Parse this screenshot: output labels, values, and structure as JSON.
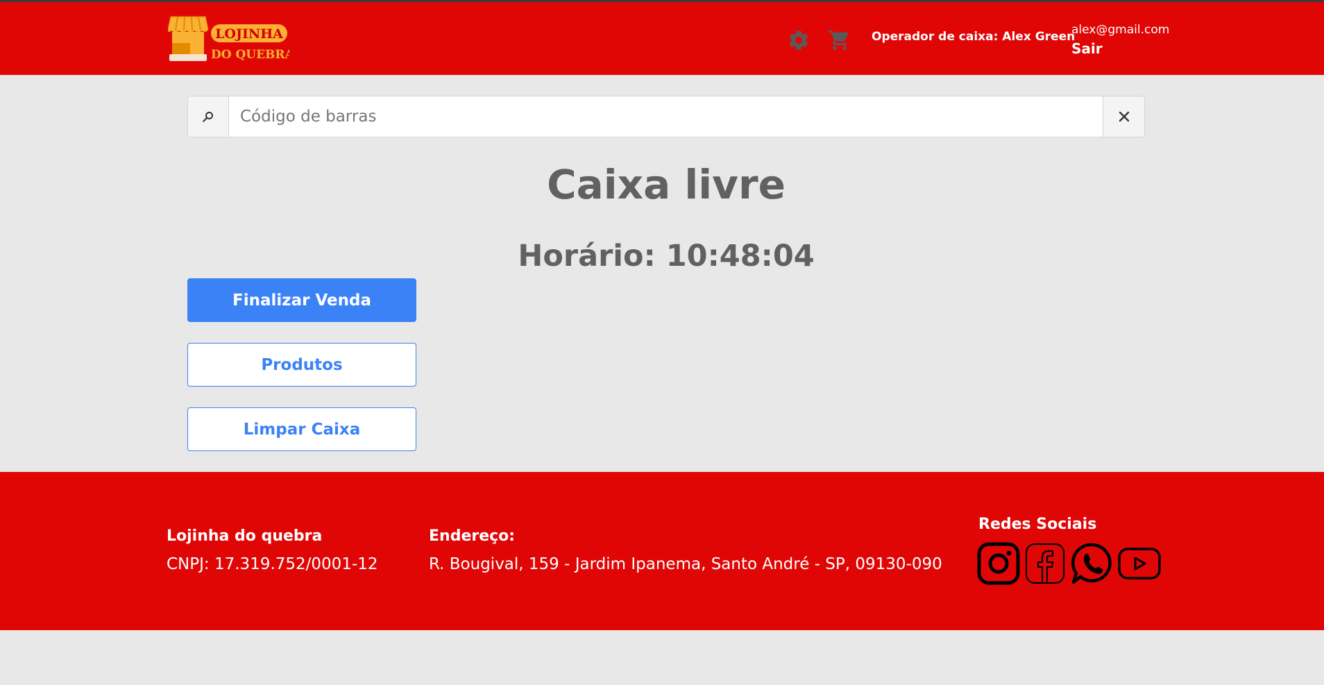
{
  "header": {
    "logo_line1": "LOJINHA",
    "logo_line2": "DO QUEBRA",
    "operator": "Operador de caixa: Alex Green",
    "email": "alex@gmail.com",
    "logout_label": "Sair",
    "icons": [
      "gear-icon",
      "cart-icon"
    ]
  },
  "search": {
    "placeholder": "Código de barras",
    "value": "",
    "search_icon": "search-icon",
    "clear_icon": "close-icon"
  },
  "main": {
    "status_title": "Caixa livre",
    "clock_label": "Horário:",
    "clock_value": "10:48:04",
    "clock_text": "Horário: 10:48:04",
    "buttons": {
      "finalize": "Finalizar Venda",
      "products": "Produtos",
      "clear": "Limpar Caixa"
    }
  },
  "footer": {
    "store_name": "Lojinha do quebra",
    "cnpj": "CNPJ: 17.319.752/0001-12",
    "address_title": "Endereço:",
    "address": "R. Bougival, 159 - Jardim Ipanema, Santo André - SP, 09130-090",
    "social_title": "Redes Sociais",
    "social_icons": [
      "instagram-icon",
      "facebook-icon",
      "whatsapp-icon",
      "youtube-icon"
    ]
  },
  "colors": {
    "brand_red": "#e10606",
    "accent_blue": "#3b82f6",
    "background": "#e8e8e8",
    "heading_gray": "#616161",
    "logo_yellow": "#f9b233"
  }
}
